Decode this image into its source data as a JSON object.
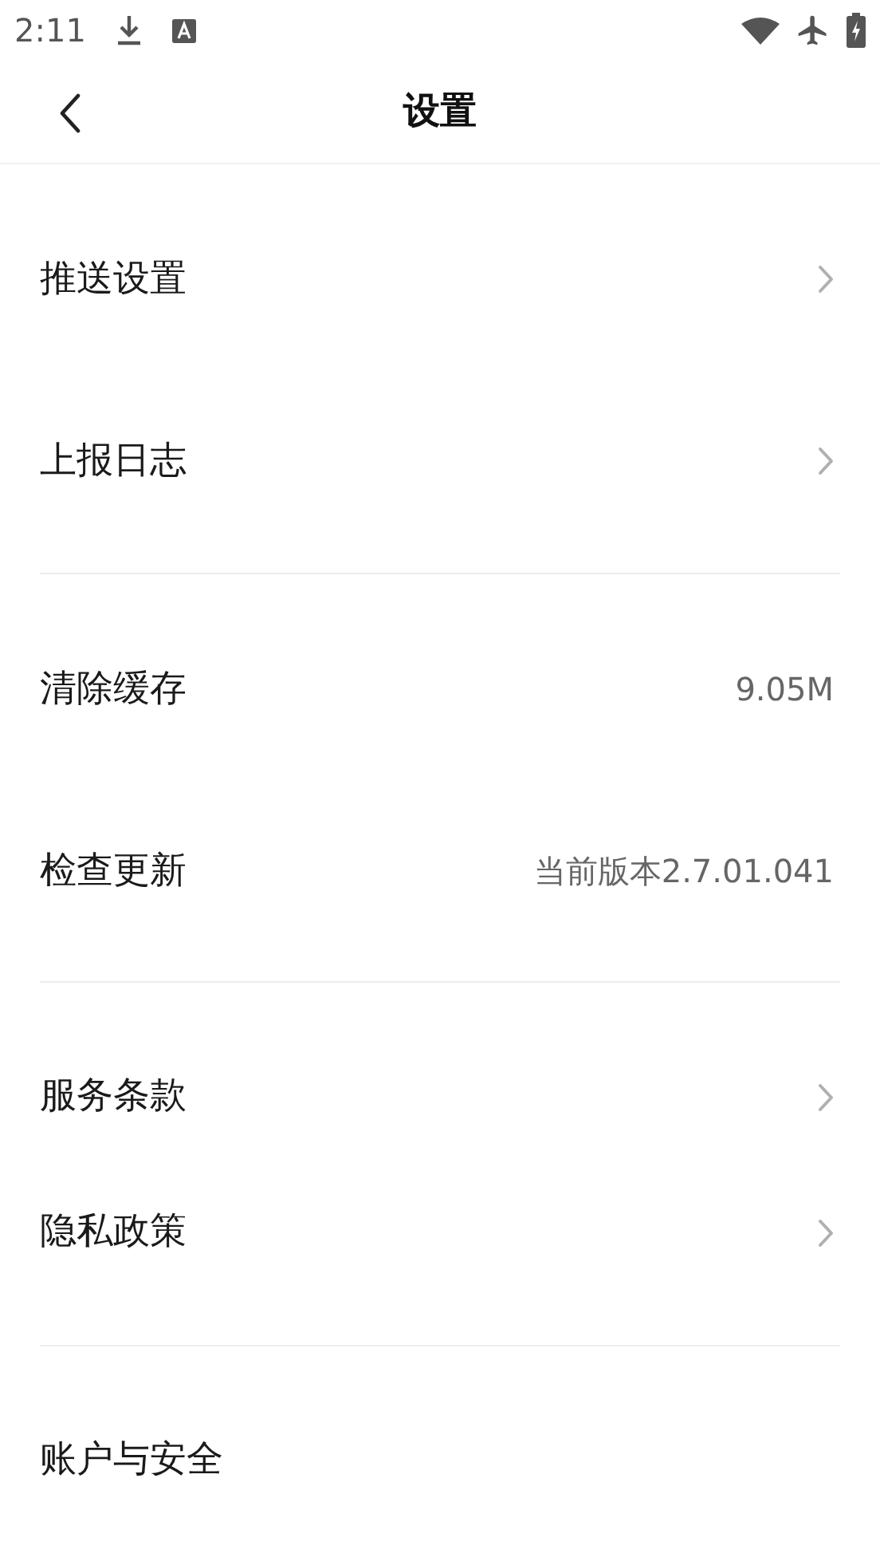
{
  "status_bar": {
    "time": "2:11"
  },
  "header": {
    "title": "设置"
  },
  "groups": [
    {
      "items": [
        {
          "label": "推送设置",
          "kind": "link"
        },
        {
          "label": "上报日志",
          "kind": "link"
        }
      ]
    },
    {
      "items": [
        {
          "label": "清除缓存",
          "kind": "value",
          "value": "9.05M"
        },
        {
          "label": "检查更新",
          "kind": "value",
          "value": "当前版本2.7.01.041"
        }
      ]
    },
    {
      "items": [
        {
          "label": "服务条款",
          "kind": "link"
        },
        {
          "label": "隐私政策",
          "kind": "link"
        }
      ]
    },
    {
      "items": [
        {
          "label": "账户与安全",
          "kind": "plain"
        }
      ]
    }
  ]
}
